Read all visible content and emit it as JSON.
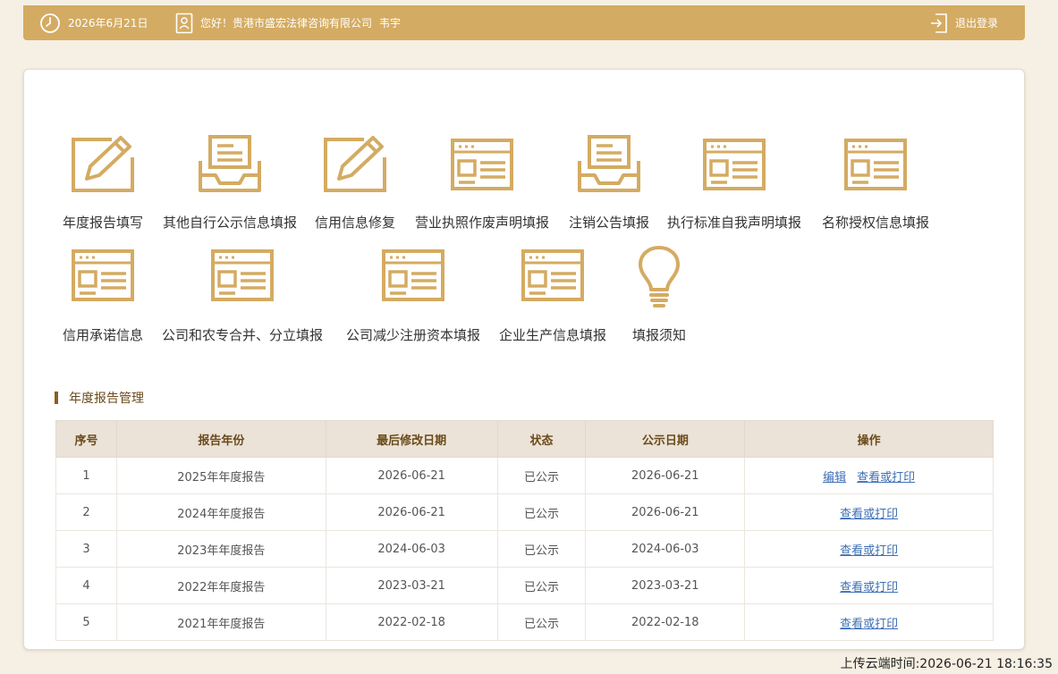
{
  "header": {
    "date": "2026年6月21日",
    "greeting": "您好！贵港市盛宏法律咨询有限公司",
    "user_name": "韦宇",
    "logout_label": "退出登录",
    "bg_color": "#d4ab62"
  },
  "tiles": [
    {
      "label": "年度报告填写",
      "icon": "edit-icon"
    },
    {
      "label": "其他自行公示信息填报",
      "icon": "inbox-icon"
    },
    {
      "label": "信用信息修复",
      "icon": "edit-icon"
    },
    {
      "label": "营业执照作废声明填报",
      "icon": "form-window-icon"
    },
    {
      "label": "注销公告填报",
      "icon": "inbox-icon"
    },
    {
      "label": "执行标准自我声明填报",
      "icon": "form-window-icon"
    },
    {
      "label": "名称授权信息填报",
      "icon": "form-window-icon"
    },
    {
      "label": "信用承诺信息",
      "icon": "form-window-icon"
    },
    {
      "label": "公司和农专合并、分立填报",
      "icon": "form-window-icon"
    },
    {
      "label": "公司减少注册资本填报",
      "icon": "form-window-icon"
    },
    {
      "label": "企业生产信息填报",
      "icon": "form-window-icon"
    },
    {
      "label": "填报须知",
      "icon": "lightbulb-icon"
    }
  ],
  "section_title": "年度报告管理",
  "table": {
    "headers": [
      "序号",
      "报告年份",
      "最后修改日期",
      "状态",
      "公示日期",
      "操作"
    ],
    "rows": [
      {
        "no": "1",
        "year": "2025年年度报告",
        "modified": "2026-06-21",
        "status": "已公示",
        "published": "2026-06-21",
        "actions": [
          "编辑",
          "查看或打印"
        ]
      },
      {
        "no": "2",
        "year": "2024年年度报告",
        "modified": "2026-06-21",
        "status": "已公示",
        "published": "2026-06-21",
        "actions": [
          "查看或打印"
        ]
      },
      {
        "no": "3",
        "year": "2023年年度报告",
        "modified": "2024-06-03",
        "status": "已公示",
        "published": "2024-06-03",
        "actions": [
          "查看或打印"
        ]
      },
      {
        "no": "4",
        "year": "2022年年度报告",
        "modified": "2023-03-21",
        "status": "已公示",
        "published": "2023-03-21",
        "actions": [
          "查看或打印"
        ]
      },
      {
        "no": "5",
        "year": "2021年年度报告",
        "modified": "2022-02-18",
        "status": "已公示",
        "published": "2022-02-18",
        "actions": [
          "查看或打印"
        ]
      }
    ]
  },
  "upload_time": "上传云端时间:2026-06-21 18:16:35",
  "accent_color": "#d4ab62"
}
